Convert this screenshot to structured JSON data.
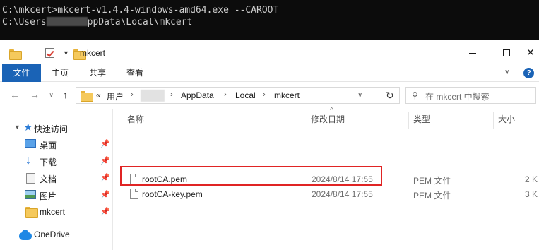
{
  "console": {
    "line1": "C:\\mkcert>mkcert-v1.4.4-windows-amd64.exe --CAROOT",
    "line2_prefix": "C:\\Users",
    "line2_suffix": "ppData\\Local\\mkcert"
  },
  "window": {
    "title": "mkcert",
    "controls": {
      "minimize": "—",
      "maximize": "□",
      "close": "✕"
    }
  },
  "ribbon": {
    "tabs": [
      "文件",
      "主页",
      "共享",
      "查看"
    ],
    "expand_icon": "chevron-down-icon",
    "help": "?"
  },
  "nav": {
    "back": "←",
    "forward": "→",
    "history": "∨",
    "up": "↑"
  },
  "address": {
    "overflow": "«",
    "crumbs": [
      "用户",
      "AppData",
      "Local",
      "mkcert"
    ],
    "sep": "›",
    "dropdown": "∨",
    "refresh": "↻"
  },
  "search": {
    "placeholder": "在 mkcert 中搜索"
  },
  "sidebar": {
    "quick_access": "快速访问",
    "items": [
      {
        "label": "桌面",
        "icon": "desktop-icon"
      },
      {
        "label": "下载",
        "icon": "download-icon"
      },
      {
        "label": "文档",
        "icon": "document-icon"
      },
      {
        "label": "图片",
        "icon": "picture-icon"
      },
      {
        "label": "mkcert",
        "icon": "folder-icon"
      }
    ],
    "onedrive": "OneDrive"
  },
  "file_list": {
    "sort_indicator": "^",
    "columns": {
      "name": "名称",
      "modified": "修改日期",
      "type": "类型",
      "size": "大小"
    },
    "rows": [
      {
        "name": "rootCA.pem",
        "modified": "2024/8/14 17:55",
        "type": "PEM 文件",
        "size": "2 K"
      },
      {
        "name": "rootCA-key.pem",
        "modified": "2024/8/14 17:55",
        "type": "PEM 文件",
        "size": "3 K"
      }
    ],
    "highlight_color": "#e02424"
  }
}
